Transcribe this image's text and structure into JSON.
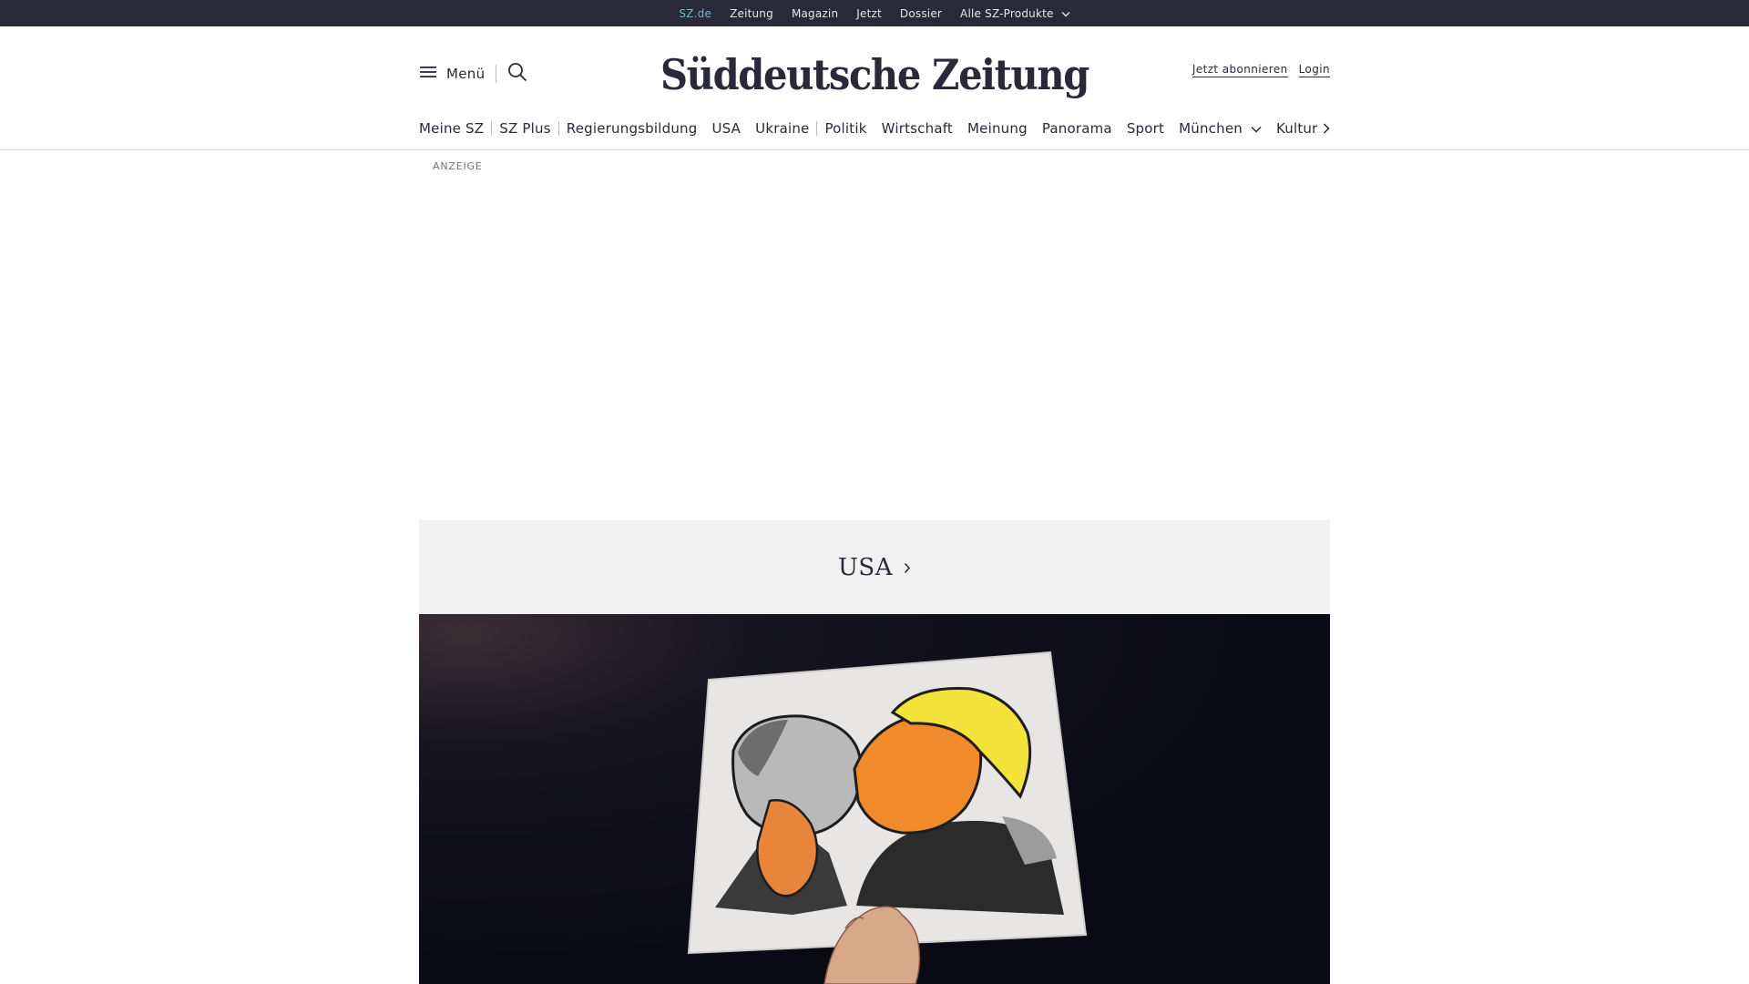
{
  "topbar": {
    "items": [
      "SZ.de",
      "Zeitung",
      "Magazin",
      "Jetzt",
      "Dossier",
      "Alle SZ-Produkte"
    ]
  },
  "header": {
    "menu_label": "Menü",
    "logo_text": "Süddeutsche Zeitung",
    "subscribe_label": "Jetzt abonnieren",
    "login_label": "Login"
  },
  "nav": {
    "items": [
      "Meine SZ",
      "SZ Plus",
      "Regierungsbildung",
      "USA",
      "Ukraine",
      "Politik",
      "Wirtschaft",
      "Meinung",
      "Panorama",
      "Sport",
      "München",
      "Kultur"
    ]
  },
  "ad": {
    "label": "ANZEIGE"
  },
  "section": {
    "title": "USA"
  },
  "colors": {
    "topbar_bg": "#29293a",
    "topbar_active": "#71b8c3",
    "text": "#29293a",
    "banner_bg": "#f1f1f1"
  },
  "icons": [
    "hamburger-icon",
    "search-icon",
    "chevron-down-icon",
    "chevron-right-icon"
  ]
}
